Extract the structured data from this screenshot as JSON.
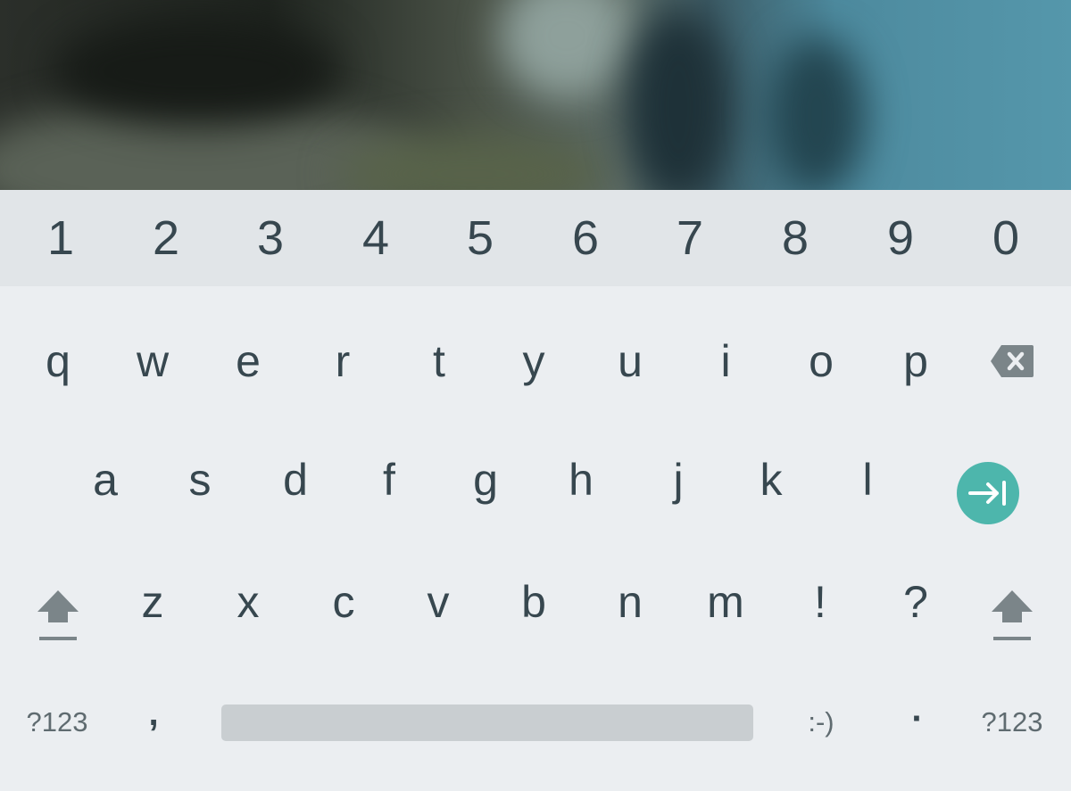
{
  "keyboard": {
    "number_row": [
      "1",
      "2",
      "3",
      "4",
      "5",
      "6",
      "7",
      "8",
      "9",
      "0"
    ],
    "row1": [
      "q",
      "w",
      "e",
      "r",
      "t",
      "y",
      "u",
      "i",
      "o",
      "p"
    ],
    "row2": [
      "a",
      "s",
      "d",
      "f",
      "g",
      "h",
      "j",
      "k",
      "l"
    ],
    "row3": [
      "z",
      "x",
      "c",
      "v",
      "b",
      "n",
      "m",
      "!",
      "?"
    ],
    "bottom": {
      "symbols_left": "?123",
      "comma": ",",
      "emoticon": ":-)",
      "period": "·",
      "symbols_right": "?123"
    },
    "icons": {
      "backspace": "backspace-icon",
      "tab": "tab-next-icon",
      "shift_left": "shift-icon",
      "shift_right": "shift-icon"
    },
    "colors": {
      "accent": "#4db6ac",
      "key_text": "#37474f",
      "icon": "#7b8589",
      "number_row_bg": "#e1e5e8",
      "keyboard_bg": "#ebeef1",
      "space_bar": "#c9ced1"
    }
  }
}
